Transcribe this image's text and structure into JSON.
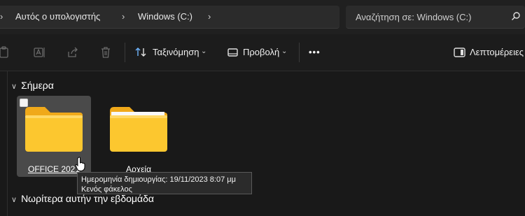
{
  "address_bar": {
    "crumbs": [
      "Αυτός ο υπολογιστής",
      "Windows (C:)"
    ]
  },
  "search": {
    "placeholder": "Αναζήτηση σε: Windows (C:)"
  },
  "toolbar": {
    "sort_label": "Ταξινόμηση",
    "view_label": "Προβολή",
    "more_label": "•••",
    "details_label": "Λεπτομέρειες"
  },
  "groups": [
    {
      "header": "Σήμερα",
      "items": [
        {
          "name": "OFFICE 2021",
          "selected": true
        },
        {
          "name": "Αρχεία",
          "selected": false
        }
      ]
    },
    {
      "header": "Νωρίτερα αυτήν την εβδομάδα",
      "items": []
    }
  ],
  "tooltip": {
    "line1": "Ημερομηνία δημιουργίας: 19/11/2023 8:07 μμ",
    "line2": "Κενός φάκελος"
  },
  "colors": {
    "background": "#191919",
    "folder_body": "#fcc72f",
    "folder_back": "#f0a91a",
    "selection": "#4a4a4a"
  }
}
